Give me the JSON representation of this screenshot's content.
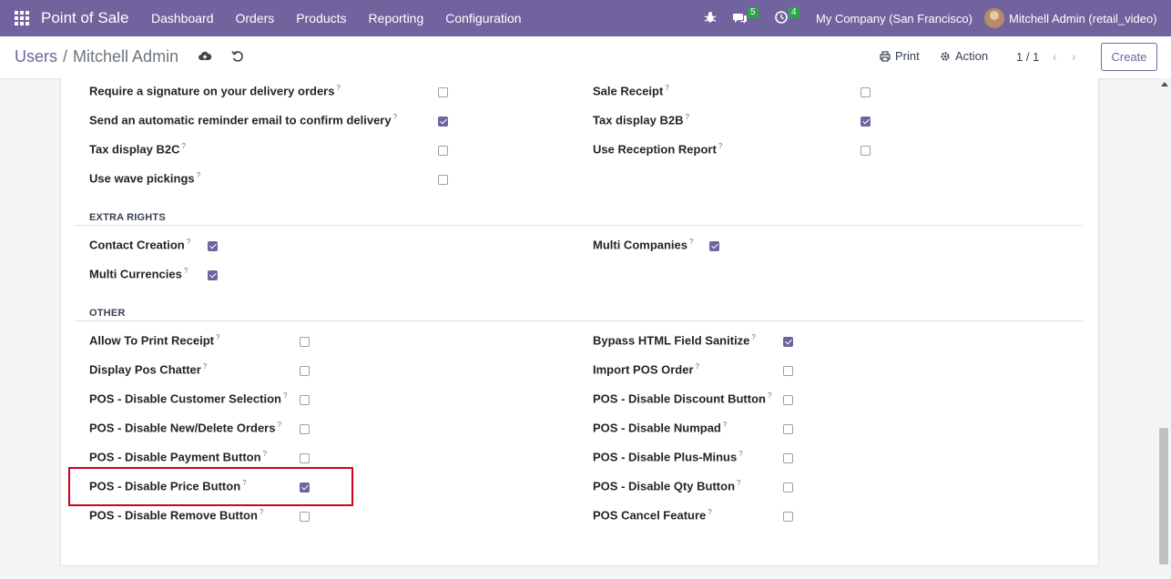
{
  "navbar": {
    "app_name": "Point of Sale",
    "menu": [
      "Dashboard",
      "Orders",
      "Products",
      "Reporting",
      "Configuration"
    ],
    "chat_count": "5",
    "activity_count": "4",
    "company": "My Company (San Francisco)",
    "user": "Mitchell Admin (retail_video)"
  },
  "control": {
    "breadcrumb_parent": "Users",
    "breadcrumb_current": "Mitchell Admin",
    "print_label": "Print",
    "action_label": "Action",
    "pager": "1 / 1",
    "create_label": "Create"
  },
  "rows_top": [
    {
      "label": "Require a signature on your delivery orders",
      "checked": false
    },
    {
      "label": "Send an automatic reminder email to confirm delivery",
      "checked": true
    },
    {
      "label": "Tax display B2C",
      "checked": false
    },
    {
      "label": "Use wave pickings",
      "checked": false
    }
  ],
  "rows_top_right": [
    {
      "label": "Sale Receipt",
      "checked": false
    },
    {
      "label": "Tax display B2B",
      "checked": true
    },
    {
      "label": "Use Reception Report",
      "checked": false
    }
  ],
  "extra_rights": {
    "title": "EXTRA RIGHTS",
    "left": [
      {
        "label": "Contact Creation",
        "checked": true
      },
      {
        "label": "Multi Currencies",
        "checked": true
      }
    ],
    "right": [
      {
        "label": "Multi Companies",
        "checked": true
      }
    ]
  },
  "other": {
    "title": "OTHER",
    "left": [
      {
        "label": "Allow To Print Receipt",
        "checked": false
      },
      {
        "label": "Display Pos Chatter",
        "checked": false
      },
      {
        "label": "POS - Disable Customer Selection",
        "checked": false
      },
      {
        "label": "POS - Disable New/Delete Orders",
        "checked": false
      },
      {
        "label": "POS - Disable Payment Button",
        "checked": false
      },
      {
        "label": "POS - Disable Price Button",
        "checked": true
      },
      {
        "label": "POS - Disable Remove Button",
        "checked": false
      }
    ],
    "right": [
      {
        "label": "Bypass HTML Field Sanitize",
        "checked": true
      },
      {
        "label": "Import POS Order",
        "checked": false
      },
      {
        "label": "POS - Disable Discount Button",
        "checked": false
      },
      {
        "label": "POS - Disable Numpad",
        "checked": false
      },
      {
        "label": "POS - Disable Plus-Minus",
        "checked": false
      },
      {
        "label": "POS - Disable Qty Button",
        "checked": false
      },
      {
        "label": "POS Cancel Feature",
        "checked": false
      }
    ]
  },
  "help_mark": "?",
  "colors": {
    "brand": "#71639e",
    "badge": "#28a745",
    "highlight": "#d0021b"
  }
}
